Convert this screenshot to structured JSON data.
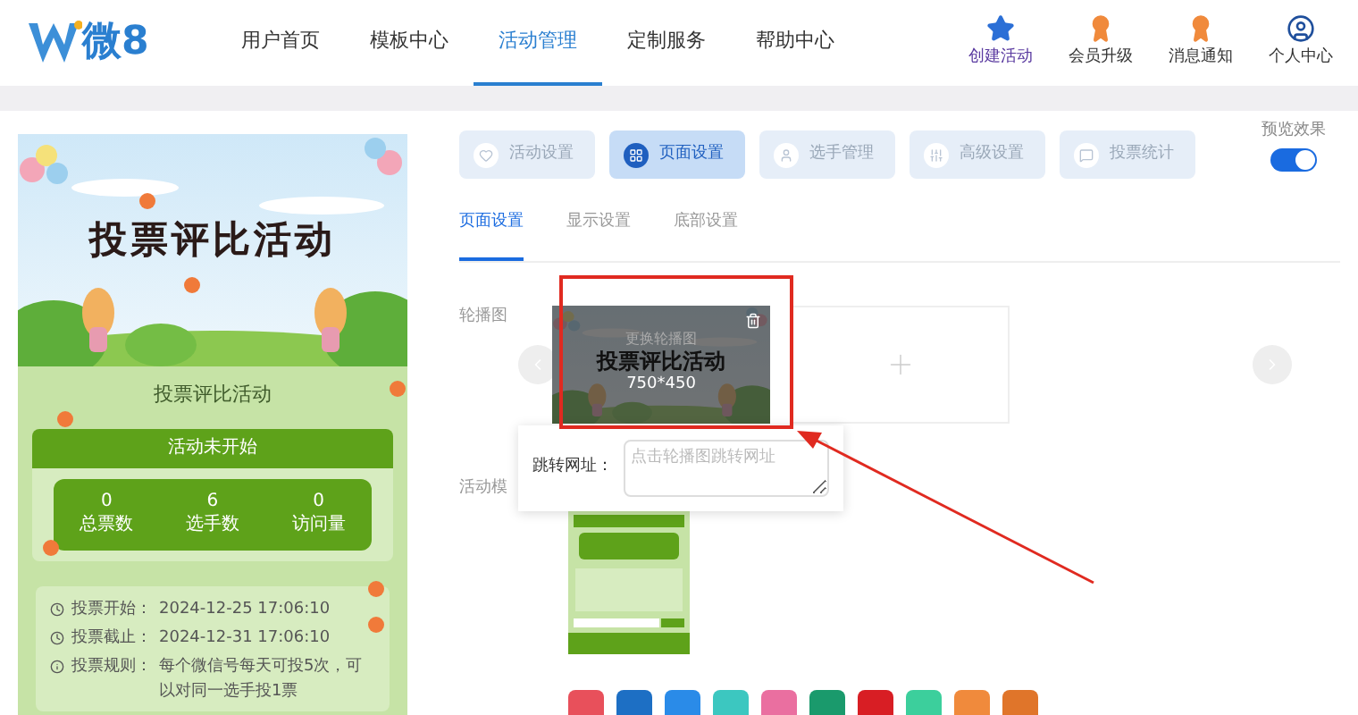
{
  "logo": {
    "text": "微8"
  },
  "nav": [
    {
      "label": "用户首页",
      "selected": false
    },
    {
      "label": "模板中心",
      "selected": false
    },
    {
      "label": "活动管理",
      "selected": true
    },
    {
      "label": "定制服务",
      "selected": false
    },
    {
      "label": "帮助中心",
      "selected": false
    }
  ],
  "actions": [
    {
      "label": "创建活动",
      "kind": "star"
    },
    {
      "label": "会员升级",
      "kind": "badge"
    },
    {
      "label": "消息通知",
      "kind": "badge"
    },
    {
      "label": "个人中心",
      "kind": "user"
    }
  ],
  "preview": {
    "banner_title": "投票评比活动",
    "title": "投票评比活动",
    "status": "活动未开始",
    "stats": [
      {
        "value": "0",
        "label": "总票数"
      },
      {
        "value": "6",
        "label": "选手数"
      },
      {
        "value": "0",
        "label": "访问量"
      }
    ],
    "info": [
      {
        "kind": "clock",
        "label": "投票开始：",
        "value": "2024-12-25 17:06:10"
      },
      {
        "kind": "clock",
        "label": "投票截止：",
        "value": "2024-12-31 17:06:10"
      },
      {
        "kind": "info",
        "label": "投票规则：",
        "value": "每个微信号每天可投5次，可以对同一选手投1票"
      }
    ]
  },
  "steps": [
    {
      "label": "活动设置",
      "kind": "heart",
      "selected": false
    },
    {
      "label": "页面设置",
      "kind": "grid",
      "selected": true
    },
    {
      "label": "选手管理",
      "kind": "user",
      "selected": false
    },
    {
      "label": "高级设置",
      "kind": "sliders",
      "selected": false
    },
    {
      "label": "投票统计",
      "kind": "chat",
      "selected": false
    }
  ],
  "preview_toggle": {
    "label": "预览效果",
    "on": true
  },
  "subtabs": [
    {
      "label": "页面设置",
      "selected": true
    },
    {
      "label": "显示设置",
      "selected": false
    },
    {
      "label": "底部设置",
      "selected": false
    }
  ],
  "carousel": {
    "label": "轮播图",
    "slide": {
      "overlay": "更换轮播图",
      "title": "投票评比活动",
      "size": "750*450"
    }
  },
  "link_popover": {
    "label": "跳转网址：",
    "placeholder": "点击轮播图跳转网址"
  },
  "template": {
    "label": "活动模"
  },
  "swatches": [
    {
      "color": "#e8505b"
    },
    {
      "color": "#1d6fc4"
    },
    {
      "color": "#2a8be8"
    },
    {
      "color": "#3cc7c0"
    },
    {
      "color": "#ea6fa0"
    },
    {
      "color": "#1a9a6c"
    },
    {
      "color": "#d81e24"
    },
    {
      "color": "#3ccf9c"
    },
    {
      "color": "#f08a3c"
    },
    {
      "color": "#e0752a"
    }
  ]
}
